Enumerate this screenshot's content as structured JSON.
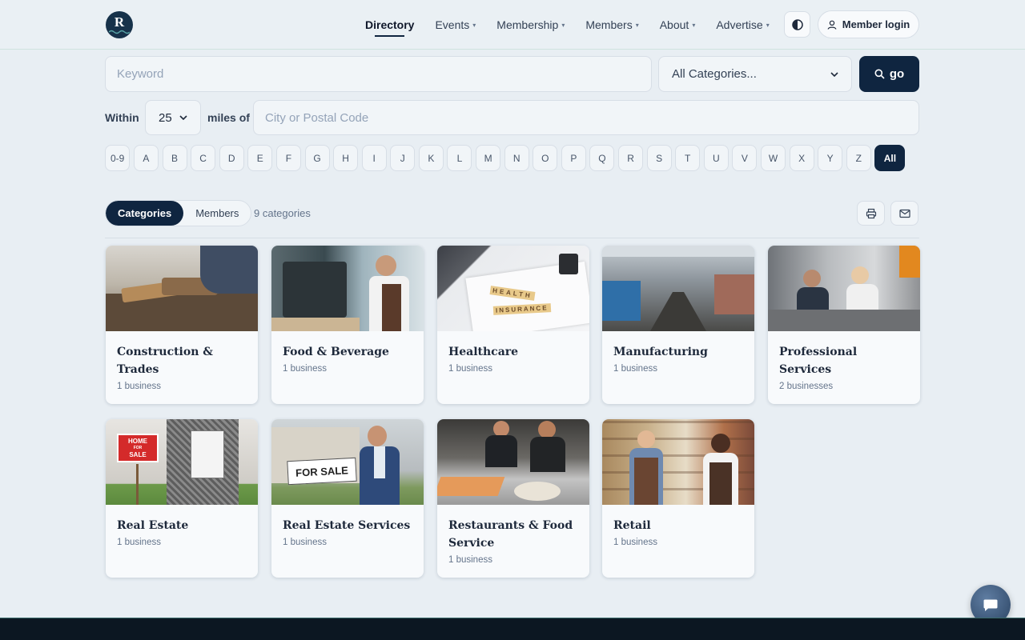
{
  "brand": {
    "logo_letter": "R"
  },
  "nav": [
    {
      "label": "Directory",
      "active": true,
      "caret": false
    },
    {
      "label": "Events",
      "caret": true
    },
    {
      "label": "Membership",
      "caret": true
    },
    {
      "label": "Members",
      "caret": true
    },
    {
      "label": "About",
      "caret": true
    },
    {
      "label": "Advertise",
      "caret": true
    }
  ],
  "header": {
    "login_label": "Member login"
  },
  "search": {
    "keyword_placeholder": "Keyword",
    "category_value": "All Categories...",
    "go_label": "go",
    "within_label": "Within",
    "miles_value": "25",
    "miles_of_label": "miles of",
    "city_placeholder": "City or Postal Code"
  },
  "letters": [
    "0-9",
    "A",
    "B",
    "C",
    "D",
    "E",
    "F",
    "G",
    "H",
    "I",
    "J",
    "K",
    "L",
    "M",
    "N",
    "O",
    "P",
    "Q",
    "R",
    "S",
    "T",
    "U",
    "V",
    "W",
    "X",
    "Y",
    "Z",
    "All"
  ],
  "letters_active": "All",
  "view": {
    "categories_label": "Categories",
    "members_label": "Members",
    "count_label": "9 categories"
  },
  "cards": [
    {
      "title": "Construction & Trades",
      "sub": "1 business"
    },
    {
      "title": "Food & Beverage",
      "sub": "1 business"
    },
    {
      "title": "Healthcare",
      "sub": "1 business"
    },
    {
      "title": "Manufacturing",
      "sub": "1 business"
    },
    {
      "title": "Professional Services",
      "sub": "2 businesses"
    },
    {
      "title": "Real Estate",
      "sub": "1 business"
    },
    {
      "title": "Real Estate Services",
      "sub": "1 business"
    },
    {
      "title": "Restaurants & Food Service",
      "sub": "1 business"
    },
    {
      "title": "Retail",
      "sub": "1 business"
    }
  ],
  "image_text": {
    "health_line1": "HEALTH",
    "health_line2": "INSURANCE",
    "home_sign_1": "HOME",
    "home_sign_2": "FOR",
    "home_sign_3": "SALE",
    "for_sale": "FOR SALE"
  },
  "colors": {
    "primary": "#0f2540",
    "background": "#e8eef3"
  },
  "icons": [
    "contrast-icon",
    "user-icon",
    "search-icon",
    "printer-icon",
    "mail-icon",
    "chat-icon",
    "chevron-down-icon"
  ]
}
